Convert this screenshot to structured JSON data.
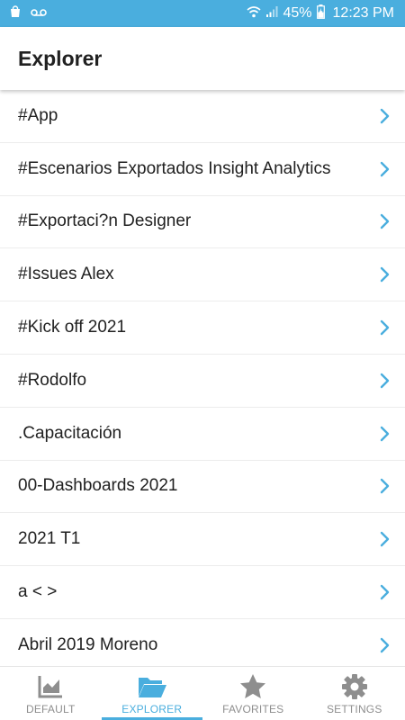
{
  "status_bar": {
    "battery": "45%",
    "time": "12:23 PM"
  },
  "app_bar": {
    "title": "Explorer"
  },
  "list": {
    "items": [
      {
        "label": "#App"
      },
      {
        "label": "#Escenarios Exportados Insight Analytics"
      },
      {
        "label": "#Exportaci?n Designer"
      },
      {
        "label": "#Issues Alex"
      },
      {
        "label": "#Kick off 2021"
      },
      {
        "label": "#Rodolfo"
      },
      {
        "label": ".Capacitación"
      },
      {
        "label": "00-Dashboards 2021"
      },
      {
        "label": "2021 T1"
      },
      {
        "label": "a < >"
      },
      {
        "label": "Abril 2019 Moreno"
      }
    ]
  },
  "bottom_nav": {
    "tabs": [
      {
        "label": "DEFAULT",
        "icon": "chart-icon"
      },
      {
        "label": "EXPLORER",
        "icon": "folder-open-icon"
      },
      {
        "label": "FAVORITES",
        "icon": "star-icon"
      },
      {
        "label": "SETTINGS",
        "icon": "gear-icon"
      }
    ],
    "active_index": 1
  },
  "colors": {
    "accent": "#4aaede",
    "text": "#212121",
    "inactive": "#8e8e8e"
  }
}
